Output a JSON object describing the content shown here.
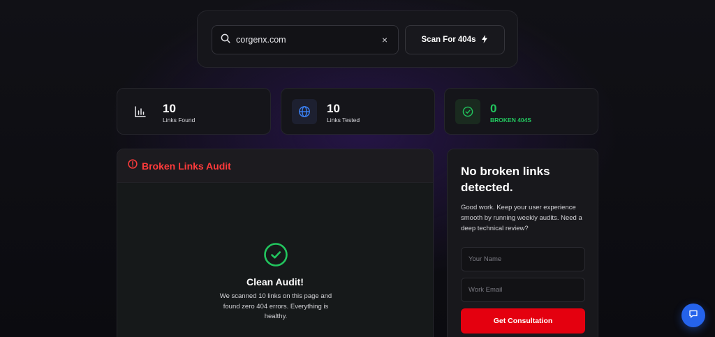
{
  "search": {
    "value": "corgenx.com",
    "clear_glyph": "×",
    "scan_label": "Scan For 404s",
    "scan_icon": "lightning-icon"
  },
  "stats": [
    {
      "value": "10",
      "label": "Links Found",
      "icon": "bar-chart-icon"
    },
    {
      "value": "10",
      "label": "Links Tested",
      "icon": "globe-icon"
    },
    {
      "value": "0",
      "label": "BROKEN 404S",
      "icon": "check-circle-icon"
    }
  ],
  "audit": {
    "title": "Broken Links Audit",
    "clean_title": "Clean Audit!",
    "clean_desc": "We scanned 10 links on this page and found zero 404 errors. Everything is healthy."
  },
  "consult": {
    "title": "No broken links detected.",
    "desc": "Good work. Keep your user experience smooth by running weekly audits. Need a deep technical review?",
    "name_placeholder": "Your Name",
    "email_placeholder": "Work Email",
    "button_label": "Get Consultation"
  },
  "colors": {
    "accent_red": "#ff3b3b",
    "cta_red": "#e4000f",
    "success_green": "#22c55e",
    "blue": "#2563eb"
  }
}
